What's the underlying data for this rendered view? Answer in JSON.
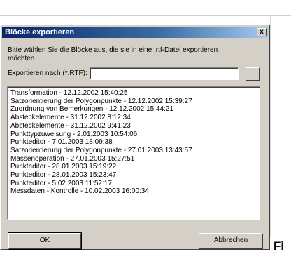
{
  "dialog": {
    "title": "Blöcke exportieren",
    "close_label": "x",
    "instruction": "Bitte wählen Sie die Blöcke aus, die sie in eine .rtf-Datei exportieren möchten.",
    "export_label": "Exportieren nach (*.RTF):",
    "export_path_value": "",
    "browse_label": "",
    "ok_label": "OK",
    "cancel_label": "Abbrechen"
  },
  "list": {
    "items": [
      "Transformation  - 12.12.2002 15:40:25",
      "Satzorientierung der Polygonpunkte  - 12.12.2002 15:39:27",
      "Zuordnung von Bemerkungen  - 12.12.2002 15:44:21",
      "Absteckelemente  - 31.12.2002 8:12:34",
      "Absteckelemente  - 31.12.2002 9:41:23",
      "Punkttypzuweisung  - 2.01.2003 10:54:06",
      "Punkteditor  - 7.01.2003 18:09:38",
      "Satzorientierung der Polygonpunkte  - 27.01.2003 13:43:57",
      "Massenoperation  - 27.01.2003 15:27:51",
      "Punkteditor  - 28.01.2003 15:19:22",
      "Punkteditor  - 28.01.2003 15:23:47",
      "Punkteditor  - 5.02.2003 11:52:17",
      "Messdaten - Kontrolle  - 10.02.2003 16:00:34"
    ]
  },
  "page": {
    "fig_fragment": "Fi"
  }
}
